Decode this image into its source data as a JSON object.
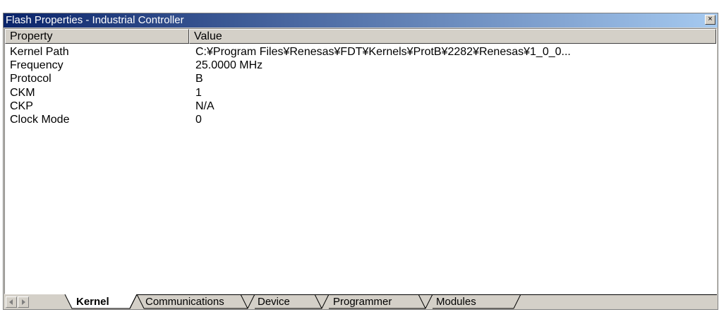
{
  "window": {
    "title": "Flash Properties - Industrial Controller",
    "close_glyph": "×"
  },
  "table": {
    "columns": [
      "Property",
      "Value"
    ],
    "rows": [
      {
        "property": "Kernel Path",
        "value": "C:¥Program Files¥Renesas¥FDT¥Kernels¥ProtB¥2282¥Renesas¥1_0_0..."
      },
      {
        "property": "Frequency",
        "value": "25.0000 MHz"
      },
      {
        "property": "Protocol",
        "value": "B"
      },
      {
        "property": "CKM",
        "value": "1"
      },
      {
        "property": "CKP",
        "value": "N/A"
      },
      {
        "property": "Clock Mode",
        "value": "0"
      }
    ]
  },
  "tabs": {
    "scroll_left_icon": "triangle-left-icon",
    "scroll_right_icon": "triangle-right-icon",
    "items": [
      {
        "label": "Kernel",
        "active": true
      },
      {
        "label": "Communications",
        "active": false
      },
      {
        "label": "Device",
        "active": false
      },
      {
        "label": "Programmer",
        "active": false
      },
      {
        "label": "Modules",
        "active": false
      }
    ]
  }
}
